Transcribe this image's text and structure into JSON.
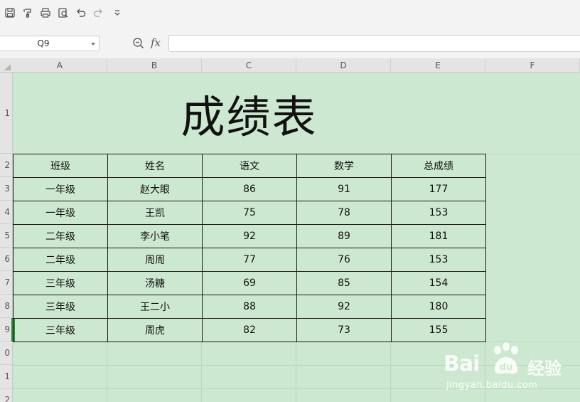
{
  "toolbar": {
    "icons": [
      "save-icon",
      "format-painter-icon",
      "print-icon",
      "print-preview-icon",
      "undo-icon",
      "redo-icon",
      "customize-toolbar-icon"
    ]
  },
  "formula_bar": {
    "name_box": "Q9",
    "fx": "fx",
    "formula_value": ""
  },
  "sheet": {
    "columns": [
      "A",
      "B",
      "C",
      "D",
      "E",
      "F"
    ],
    "rows": [
      "1",
      "2",
      "3",
      "4",
      "5",
      "6",
      "7",
      "8",
      "9",
      "0",
      "1",
      "2"
    ],
    "title": "成绩表",
    "headers": [
      "班级",
      "姓名",
      "语文",
      "数学",
      "总成绩"
    ],
    "data": [
      [
        "一年级",
        "赵大眼",
        "86",
        "91",
        "177"
      ],
      [
        "一年级",
        "王凯",
        "75",
        "78",
        "153"
      ],
      [
        "二年级",
        "李小笔",
        "92",
        "89",
        "181"
      ],
      [
        "二年级",
        "周周",
        "77",
        "76",
        "153"
      ],
      [
        "三年级",
        "汤糖",
        "69",
        "85",
        "154"
      ],
      [
        "三年级",
        "王二小",
        "88",
        "92",
        "180"
      ],
      [
        "三年级",
        "周虎",
        "82",
        "73",
        "155"
      ]
    ],
    "cell_fill_color": "#cde8d0",
    "selected_row_marker_color": "#2f8a3a"
  },
  "watermark": {
    "brand_left": "Bai",
    "brand_right": "经验",
    "url": "jingyan.baidu.com"
  }
}
